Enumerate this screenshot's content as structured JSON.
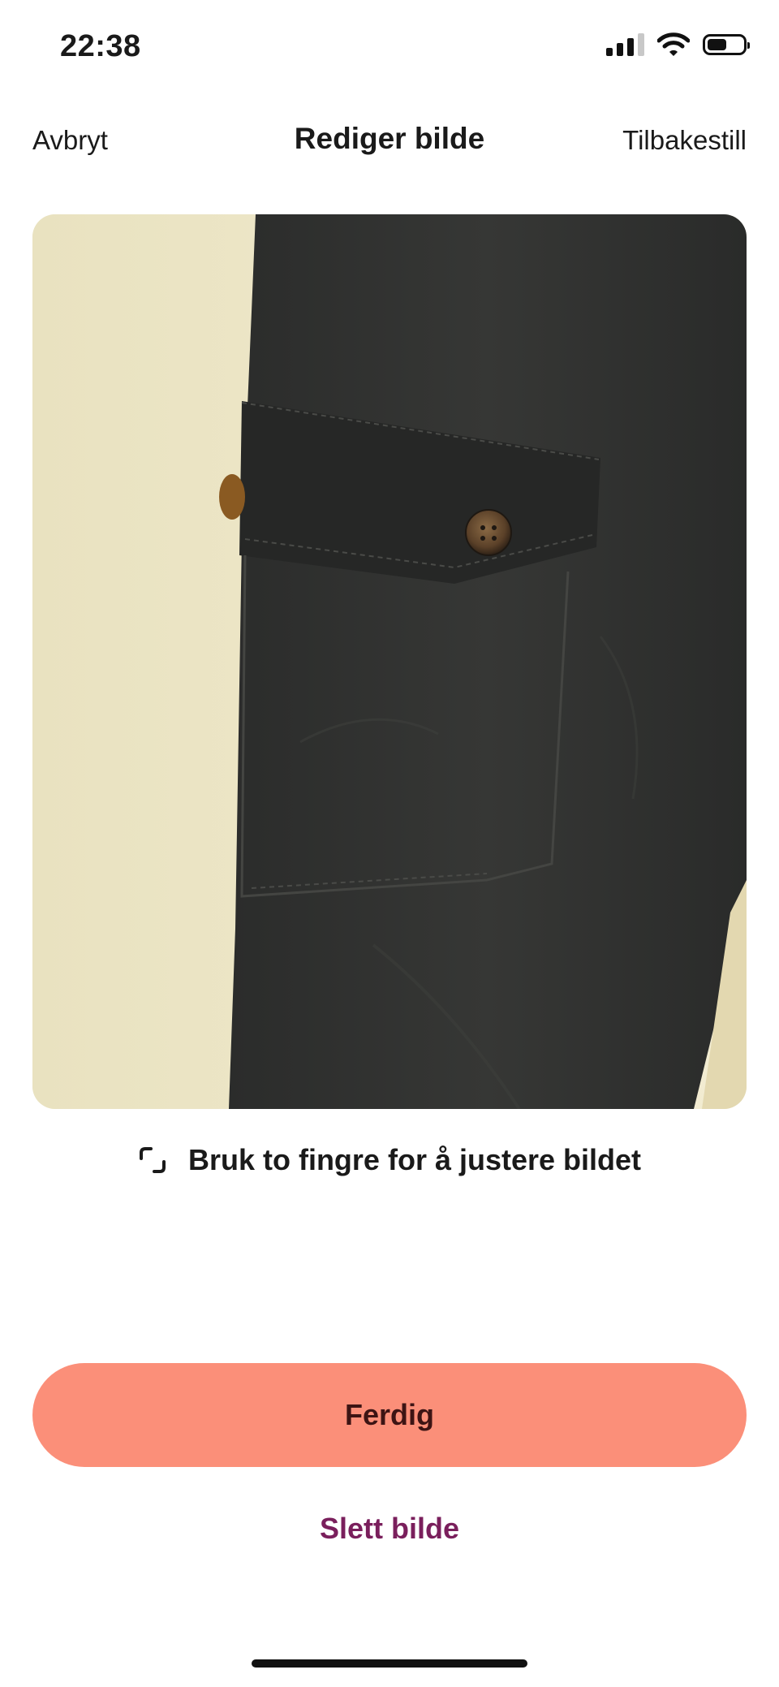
{
  "status_bar": {
    "time": "22:38",
    "battery_level": 0.55
  },
  "nav": {
    "cancel_label": "Avbryt",
    "title": "Rediger bilde",
    "reset_label": "Tilbakestill"
  },
  "photo": {
    "alt": "Bilde av svarte bukser med lomme og knapp"
  },
  "hint": {
    "icon": "crop-icon",
    "text": "Bruk to fingre for å justere bildet"
  },
  "actions": {
    "done_label": "Ferdig",
    "delete_label": "Slett bilde"
  },
  "colors": {
    "primary_button": "#fb8f79",
    "delete_text": "#7a1f5c",
    "background": "#ffffff"
  }
}
